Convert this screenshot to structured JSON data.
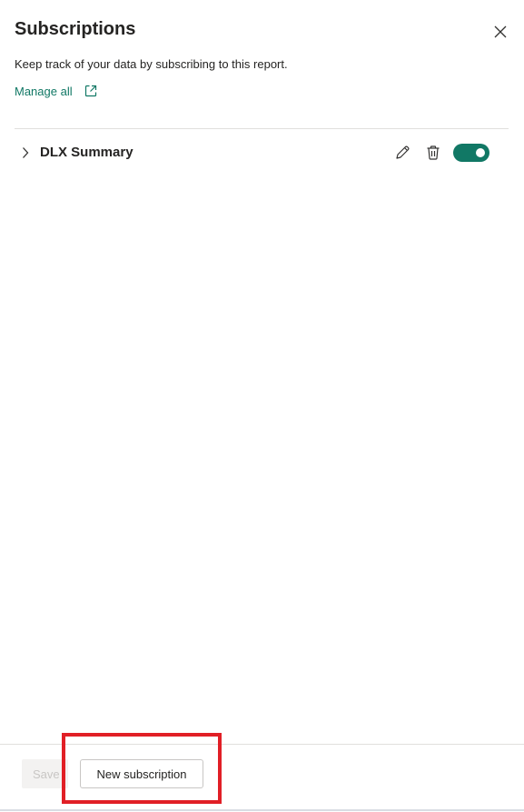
{
  "header": {
    "title": "Subscriptions",
    "description": "Keep track of your data by subscribing to this report.",
    "manage_link": "Manage all"
  },
  "subscriptions": [
    {
      "name": "DLX Summary",
      "enabled": true
    }
  ],
  "footer": {
    "save_label": "Save",
    "new_label": "New subscription"
  },
  "icons": {
    "close": "close-icon",
    "external": "external-link-icon",
    "chevron": "chevron-right-icon",
    "edit": "pencil-icon",
    "delete": "trash-icon"
  },
  "colors": {
    "accent": "#117865",
    "highlight": "#e11f26",
    "text": "#252423"
  }
}
